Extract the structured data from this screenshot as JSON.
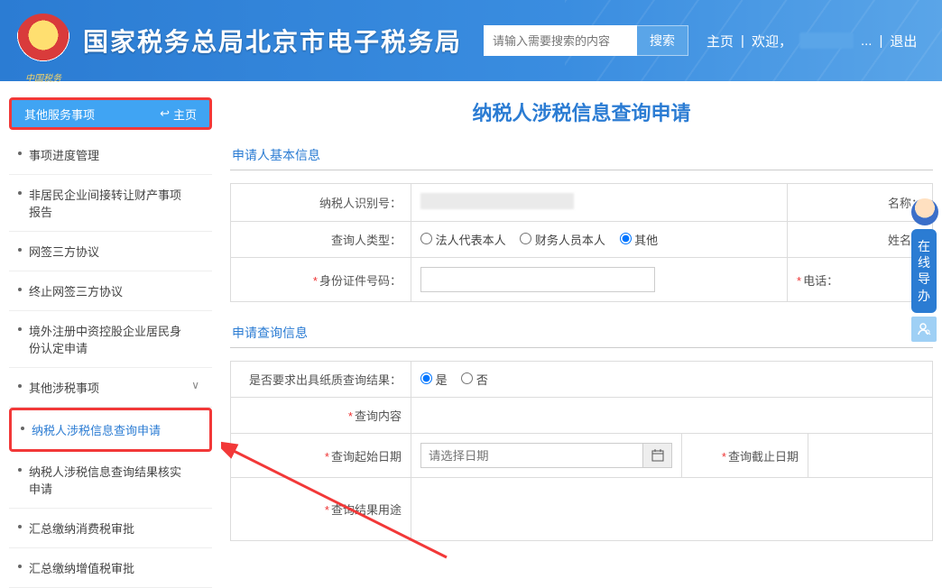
{
  "header": {
    "site_title": "国家税务总局北京市电子税务局",
    "search_placeholder": "请输入需要搜索的内容",
    "search_btn": "搜索",
    "nav_home": "主页",
    "nav_welcome": "欢迎，",
    "nav_ellipsis": "...",
    "nav_logout": "退出"
  },
  "sidebar": {
    "head_title": "其他服务事项",
    "head_back": "主页",
    "items": [
      {
        "label": "事项进度管理"
      },
      {
        "label": "非居民企业间接转让财产事项报告"
      },
      {
        "label": "网签三方协议"
      },
      {
        "label": "终止网签三方协议"
      },
      {
        "label": "境外注册中资控股企业居民身份认定申请"
      },
      {
        "label": "其他涉税事项"
      },
      {
        "label": "纳税人涉税信息查询申请"
      },
      {
        "label": "纳税人涉税信息查询结果核实申请"
      },
      {
        "label": "汇总缴纳消费税审批"
      },
      {
        "label": "汇总缴纳增值税审批"
      }
    ]
  },
  "page_title": "纳税人涉税信息查询申请",
  "section1": {
    "title": "申请人基本信息",
    "l_taxid": "纳税人识别号：",
    "l_name": "名称：",
    "l_querytype": "查询人类型：",
    "opt_legal": "法人代表本人",
    "opt_finance": "财务人员本人",
    "opt_other": "其他",
    "l_person_name": "姓名：",
    "l_idno": "身份证件号码：",
    "l_phone": "电话："
  },
  "section2": {
    "title": "申请查询信息",
    "l_paper": "是否要求出具纸质查询结果：",
    "opt_yes": "是",
    "opt_no": "否",
    "l_qcontent": "查询内容",
    "l_startdate": "查询起始日期",
    "date_placeholder": "请选择日期",
    "l_enddate": "查询截止日期",
    "l_purpose": "查询结果用途"
  },
  "float": {
    "online_guide": "在线导办"
  }
}
